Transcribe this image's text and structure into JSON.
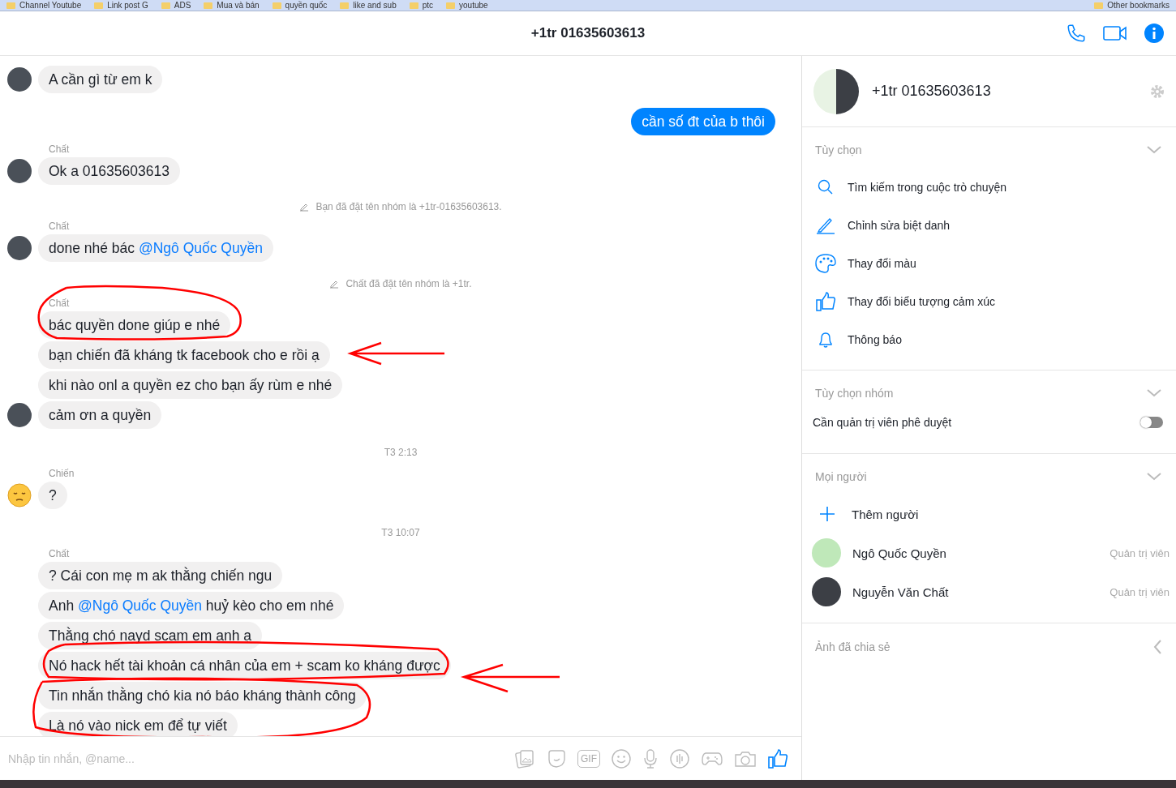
{
  "bookmarks": [
    "Channel Youtube",
    "Link post G",
    "ADS",
    "Mua và bán",
    "quyền quốc",
    "like and sub",
    "ptc",
    "youtube"
  ],
  "other_bookmarks": "Other bookmarks",
  "header": {
    "title": "+1tr 01635603613"
  },
  "messages": [
    {
      "kind": "incoming",
      "avatar": {
        "kind": "photo"
      },
      "bubbles": [
        {
          "parts": [
            {
              "text": "A cần gì từ em k"
            }
          ]
        }
      ]
    },
    {
      "kind": "outgoing",
      "bubbles": [
        {
          "parts": [
            {
              "text": "cần số đt của b thôi"
            }
          ]
        }
      ]
    },
    {
      "kind": "incoming",
      "sender": "Chất",
      "avatar": {
        "kind": "photo"
      },
      "bubbles": [
        {
          "parts": [
            {
              "text": "Ok a 01635603613"
            }
          ]
        }
      ]
    },
    {
      "kind": "system",
      "text": "Bạn đã đặt tên nhóm là +1tr-01635603613."
    },
    {
      "kind": "incoming",
      "sender": "Chất",
      "avatar": {
        "kind": "photo"
      },
      "bubbles": [
        {
          "parts": [
            {
              "text": "done nhé bác "
            },
            {
              "text": "@Ngô Quốc Quyền",
              "mention": true
            }
          ]
        }
      ]
    },
    {
      "kind": "system",
      "text": "Chất đã đặt tên nhóm là +1tr."
    },
    {
      "kind": "incoming",
      "sender": "Chất",
      "avatar": {
        "kind": "photo"
      },
      "bubbles": [
        {
          "parts": [
            {
              "text": "bác quyền done giúp e nhé"
            }
          ]
        },
        {
          "parts": [
            {
              "text": "bạn chiến đã kháng tk facebook cho e rồi ạ"
            }
          ]
        },
        {
          "parts": [
            {
              "text": "khi nào onl a quyền ez cho bạn ấy rùm e nhé"
            }
          ]
        },
        {
          "parts": [
            {
              "text": "cảm ơn a quyền"
            }
          ]
        }
      ]
    },
    {
      "kind": "time",
      "text": "T3 2:13"
    },
    {
      "kind": "incoming",
      "sender": "Chiến",
      "avatar": {
        "kind": "sad-face"
      },
      "bubbles": [
        {
          "parts": [
            {
              "text": "?"
            }
          ]
        }
      ]
    },
    {
      "kind": "time",
      "text": "T3 10:07"
    },
    {
      "kind": "incoming",
      "sender": "Chất",
      "bubbles": [
        {
          "parts": [
            {
              "text": "? Cái con mẹ m ak thằng chiến ngu"
            }
          ]
        },
        {
          "parts": [
            {
              "text": "Anh "
            },
            {
              "text": "@Ngô Quốc Quyền",
              "mention": true
            },
            {
              "text": " huỷ kèo cho em nhé"
            }
          ]
        },
        {
          "parts": [
            {
              "text": "Thằng chó nayd scam em anh ạ"
            }
          ]
        },
        {
          "parts": [
            {
              "text": "Nó hack hết tài khoản cá nhân của em + scam ko kháng được"
            }
          ]
        },
        {
          "parts": [
            {
              "text": "Tin nhắn thằng chó kia nó báo kháng thành công"
            }
          ]
        },
        {
          "parts": [
            {
              "text": "Là nó vào nick em để tự viết"
            }
          ]
        }
      ]
    }
  ],
  "composer": {
    "placeholder": "Nhập tin nhắn, @name...",
    "gif_label": "GIF"
  },
  "profile": {
    "name": "+1tr 01635603613"
  },
  "options": {
    "title": "Tùy chọn",
    "items": [
      {
        "kind": "search",
        "label": "Tìm kiếm trong cuộc trò chuyện"
      },
      {
        "kind": "pencil",
        "label": "Chỉnh sửa biệt danh"
      },
      {
        "kind": "palette",
        "label": "Thay đổi màu"
      },
      {
        "kind": "thumb",
        "label": "Thay đổi biểu tượng cảm xúc"
      },
      {
        "kind": "bell",
        "label": "Thông báo"
      }
    ]
  },
  "group_options": {
    "title": "Tùy chọn nhóm",
    "setting": {
      "label": "Cần quản trị viên phê duyệt",
      "on": false
    }
  },
  "people": {
    "title": "Mọi người",
    "add_label": "Thêm người",
    "members": [
      {
        "name": "Ngô Quốc Quyền",
        "role": "Quản trị viên",
        "avatar": {
          "kind": "cartoon"
        }
      },
      {
        "name": "Nguyễn Văn Chất",
        "role": "Quản trị viên",
        "avatar": {
          "kind": "photo"
        }
      }
    ]
  },
  "shared_photos": {
    "title": "Ảnh đã chia sẻ"
  }
}
